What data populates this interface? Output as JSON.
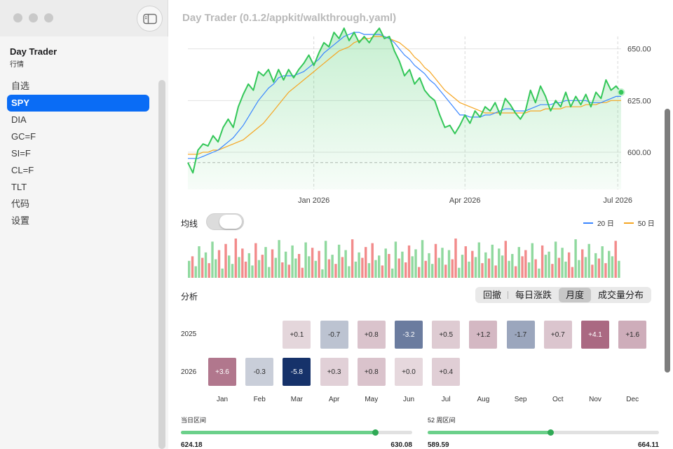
{
  "window": {
    "title": "Day Trader (0.1.2/appkit/walkthrough.yaml)"
  },
  "sidebar": {
    "title": "Day Trader",
    "subtitle": "行情",
    "items": [
      {
        "label": "自选"
      },
      {
        "label": "SPY",
        "active": true
      },
      {
        "label": "DIA"
      },
      {
        "label": "GC=F"
      },
      {
        "label": "SI=F"
      },
      {
        "label": "CL=F"
      },
      {
        "label": "TLT"
      },
      {
        "label": "代码"
      },
      {
        "label": "设置"
      }
    ]
  },
  "chart_data": [
    {
      "type": "line",
      "y_ticks": [
        "650.00",
        "625.00",
        "600.00"
      ],
      "x_ticks": [
        "Jan 2026",
        "Apr 2026",
        "Jul 2026"
      ],
      "ylim": [
        582,
        656
      ],
      "reference_line": 595,
      "x": [
        "2025-10-18",
        "2025-10-21",
        "2025-10-24",
        "2025-10-27",
        "2025-10-30",
        "2025-11-02",
        "2025-11-05",
        "2025-11-08",
        "2025-11-11",
        "2025-11-14",
        "2025-11-17",
        "2025-11-20",
        "2025-11-23",
        "2025-11-26",
        "2025-11-29",
        "2025-12-02",
        "2025-12-05",
        "2025-12-08",
        "2025-12-11",
        "2025-12-14",
        "2025-12-17",
        "2025-12-20",
        "2025-12-23",
        "2025-12-26",
        "2025-12-29",
        "2026-01-01",
        "2026-01-04",
        "2026-01-07",
        "2026-01-10",
        "2026-01-13",
        "2026-01-16",
        "2026-01-19",
        "2026-01-22",
        "2026-01-25",
        "2026-01-28",
        "2026-01-31",
        "2026-02-03",
        "2026-02-06",
        "2026-02-09",
        "2026-02-12",
        "2026-02-15",
        "2026-02-18",
        "2026-02-21",
        "2026-02-24",
        "2026-02-27",
        "2026-03-02",
        "2026-03-05",
        "2026-03-08",
        "2026-03-11",
        "2026-03-14",
        "2026-03-17",
        "2026-03-20",
        "2026-03-23",
        "2026-03-26",
        "2026-03-29",
        "2026-04-01",
        "2026-04-04",
        "2026-04-07",
        "2026-04-10",
        "2026-04-13",
        "2026-04-16",
        "2026-04-19",
        "2026-04-22",
        "2026-04-25",
        "2026-04-28",
        "2026-05-01",
        "2026-05-04",
        "2026-05-07",
        "2026-05-10",
        "2026-05-13",
        "2026-05-16",
        "2026-05-19",
        "2026-05-22",
        "2026-05-25",
        "2026-05-28",
        "2026-05-31",
        "2026-06-03",
        "2026-06-06",
        "2026-06-09",
        "2026-06-12",
        "2026-06-15",
        "2026-06-18",
        "2026-06-21",
        "2026-06-24",
        "2026-06-27",
        "2026-06-30",
        "2026-07-03"
      ],
      "series": [
        {
          "name": "",
          "color": "#34c759",
          "values": [
            595,
            590,
            601,
            604,
            603,
            608,
            605,
            612,
            616,
            612,
            622,
            628,
            633,
            630,
            639,
            637,
            640,
            634,
            640,
            635,
            640,
            636,
            640,
            643,
            647,
            642,
            648,
            653,
            651,
            658,
            655,
            660,
            654,
            658,
            653,
            656,
            653,
            657,
            660,
            655,
            656,
            649,
            644,
            637,
            640,
            633,
            636,
            630,
            627,
            625,
            618,
            612,
            613,
            609,
            613,
            618,
            614,
            620,
            617,
            622,
            620,
            624,
            618,
            626,
            623,
            619,
            616,
            620,
            630,
            624,
            632,
            627,
            620,
            625,
            622,
            629,
            622,
            627,
            623,
            628,
            622,
            629,
            626,
            635,
            630,
            632,
            629
          ]
        },
        {
          "name": "20 日",
          "color": "#3a86ff",
          "values": [
            597,
            597,
            597,
            598,
            599,
            600,
            601,
            603,
            605,
            607,
            610,
            613,
            617,
            621,
            625,
            628,
            631,
            633,
            636,
            637,
            637,
            637,
            638,
            639,
            641,
            643,
            645,
            648,
            650,
            652,
            654,
            656,
            657,
            658,
            658,
            657,
            657,
            657,
            657,
            656,
            655,
            653,
            650,
            647,
            645,
            642,
            640,
            638,
            635,
            633,
            630,
            627,
            624,
            621,
            618,
            618,
            617,
            617,
            617,
            618,
            618,
            619,
            620,
            621,
            621,
            620,
            620,
            620,
            621,
            622,
            623,
            623,
            623,
            624,
            624,
            625,
            625,
            625,
            625,
            625,
            624,
            624,
            624,
            625,
            626,
            627,
            627
          ]
        },
        {
          "name": "50 日",
          "color": "#f5a623",
          "values": [
            599,
            599,
            599,
            600,
            600,
            601,
            601,
            602,
            603,
            604,
            605,
            606,
            608,
            610,
            612,
            614,
            617,
            620,
            623,
            626,
            629,
            631,
            633,
            635,
            637,
            639,
            641,
            643,
            645,
            647,
            649,
            650,
            651,
            653,
            654,
            655,
            655,
            656,
            656,
            656,
            655,
            654,
            653,
            651,
            649,
            646,
            644,
            641,
            639,
            636,
            633,
            630,
            628,
            626,
            624,
            623,
            622,
            621,
            620,
            619,
            619,
            619,
            619,
            619,
            619,
            619,
            619,
            619,
            620,
            620,
            620,
            621,
            621,
            621,
            621,
            622,
            622,
            622,
            622,
            623,
            623,
            623,
            624,
            624,
            625,
            625,
            625
          ]
        }
      ],
      "legend": "top-right",
      "grid": true
    },
    {
      "type": "bar",
      "name": "volume",
      "colors": {
        "up": "#90d99f",
        "down": "#f28b8b"
      },
      "values": [
        22,
        28,
        15,
        41,
        26,
        33,
        19,
        47,
        24,
        36,
        12,
        44,
        29,
        18,
        51,
        27,
        38,
        21,
        32,
        16,
        45,
        23,
        30,
        40,
        14,
        37,
        26,
        49,
        20,
        34,
        17,
        42,
        25,
        31,
        13,
        46,
        28,
        39,
        22,
        35,
        11,
        48,
        24,
        30,
        18,
        43,
        27,
        36,
        15,
        50,
        21,
        33,
        26,
        40,
        19,
        45,
        23,
        29,
        16,
        38,
        31,
        12,
        47,
        25,
        34,
        20,
        42,
        28,
        37,
        14,
        49,
        22,
        32,
        18,
        44,
        26,
        39,
        17,
        36,
        24,
        51,
        13,
        30,
        41,
        21,
        35,
        27,
        46,
        19,
        33,
        25,
        43,
        16,
        38,
        29,
        48,
        22,
        31,
        15,
        40,
        28,
        36,
        20,
        45,
        24,
        12,
        42,
        30,
        34,
        18,
        47,
        26,
        39,
        21,
        33,
        14,
        50,
        23,
        37,
        27,
        44,
        17,
        32,
        25,
        41,
        19,
        35,
        28,
        48,
        22
      ],
      "up": [
        true,
        false,
        true,
        true,
        false,
        true,
        false,
        true,
        true,
        false,
        true,
        false,
        true,
        true,
        false,
        true,
        false,
        false,
        true,
        true,
        false,
        true,
        false,
        true,
        true,
        false,
        true,
        true,
        false,
        true,
        false,
        true,
        true,
        false,
        false,
        true,
        true,
        false,
        true,
        false,
        true,
        true,
        false,
        true,
        false,
        true,
        false,
        true,
        true,
        false,
        true,
        true,
        false,
        false,
        true,
        false,
        true,
        true,
        false,
        true,
        false,
        true,
        true,
        false,
        true,
        false,
        false,
        true,
        true,
        false,
        true,
        false,
        true,
        true,
        false,
        true,
        true,
        false,
        true,
        false,
        false,
        true,
        true,
        false,
        true,
        false,
        true,
        true,
        false,
        true,
        false,
        true,
        false,
        true,
        true,
        false,
        true,
        true,
        false,
        true,
        false,
        false,
        true,
        true,
        false,
        true,
        false,
        true,
        true,
        false,
        true,
        false,
        true,
        true,
        false,
        false,
        true,
        true,
        false,
        true,
        true,
        false,
        true,
        false,
        true,
        false,
        true,
        true,
        false,
        true
      ]
    }
  ],
  "toggle": {
    "label": "均线",
    "on": false
  },
  "legend": {
    "items": [
      {
        "label": "20 日",
        "color": "#3a86ff"
      },
      {
        "label": "50 日",
        "color": "#f5a623"
      }
    ]
  },
  "analysis": {
    "title": "分析",
    "tabs": [
      {
        "label": "回撤"
      },
      {
        "label": "每日涨跌"
      },
      {
        "label": "月度",
        "active": true
      },
      {
        "label": "成交量分布"
      }
    ],
    "years": [
      "2025",
      "2026"
    ],
    "months": [
      "Jan",
      "Feb",
      "Mar",
      "Apr",
      "May",
      "Jun",
      "Jul",
      "Aug",
      "Sep",
      "Oct",
      "Nov",
      "Dec"
    ],
    "returns": {
      "2025": [
        null,
        null,
        "+0.1",
        "-0.7",
        "+0.8",
        "-3.2",
        "+0.5",
        "+1.2",
        "-1.7",
        "+0.7",
        "+4.1",
        "+1.6"
      ],
      "2026": [
        "+3.6",
        "-0.3",
        "-5.8",
        "+0.3",
        "+0.8",
        "+0.0",
        "+0.4",
        null,
        null,
        null,
        null,
        null
      ]
    }
  },
  "ranges": {
    "day": {
      "title": "当日区间",
      "low": "624.18",
      "high": "630.08",
      "position": 0.84
    },
    "week52": {
      "title": "52 周区间",
      "low": "589.59",
      "high": "664.11",
      "position": 0.53
    }
  }
}
